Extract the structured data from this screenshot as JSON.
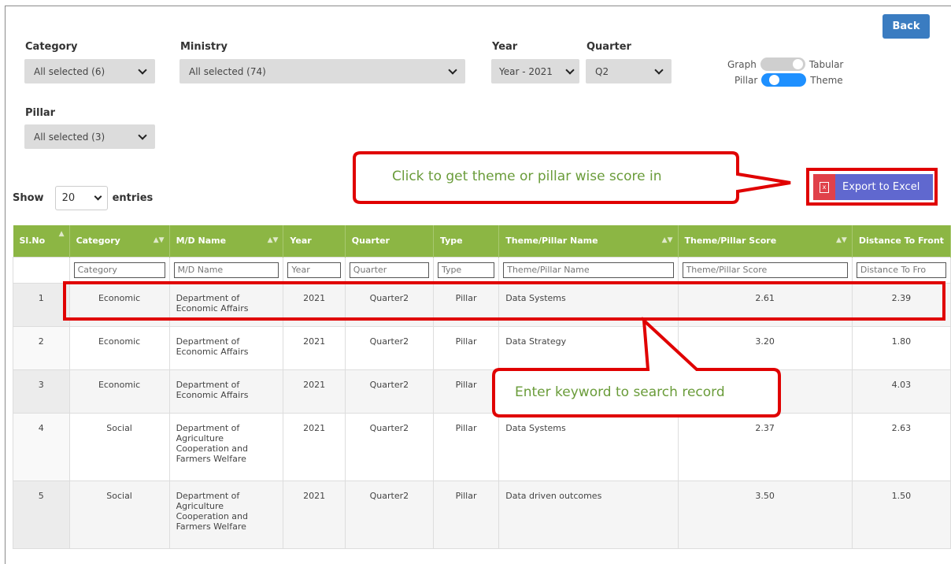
{
  "filters": {
    "category": {
      "label": "Category",
      "value": "All selected (6)"
    },
    "ministry": {
      "label": "Ministry",
      "value": "All selected (74)"
    },
    "year": {
      "label": "Year",
      "value": "Year - 2021"
    },
    "quarter": {
      "label": "Quarter",
      "value": "Q2"
    },
    "pillar": {
      "label": "Pillar",
      "value": "All selected (3)"
    }
  },
  "back_label": "Back",
  "toggles": {
    "graph_label": "Graph",
    "tabular_label": "Tabular",
    "pillar_label": "Pillar",
    "theme_label": "Theme"
  },
  "show": {
    "prefix": "Show",
    "value": "20",
    "suffix": "entries"
  },
  "export_label": "Export to Excel",
  "callouts": {
    "export": "Click to get theme or pillar wise score in",
    "search": "Enter keyword to search record"
  },
  "table": {
    "headers": [
      "Sl.No",
      "Category",
      "M/D Name",
      "Year",
      "Quarter",
      "Type",
      "Theme/Pillar Name",
      "Theme/Pillar Score",
      "Distance To Front"
    ],
    "filter_placeholders": [
      "Category",
      "M/D Name",
      "Year",
      "Quarter",
      "Type",
      "Theme/Pillar Name",
      "Theme/Pillar Score",
      "Distance To Fro"
    ],
    "rows": [
      [
        "1",
        "Economic",
        "Department of Economic Affairs",
        "2021",
        "Quarter2",
        "Pillar",
        "Data Systems",
        "2.61",
        "2.39"
      ],
      [
        "2",
        "Economic",
        "Department of Economic Affairs",
        "2021",
        "Quarter2",
        "Pillar",
        "Data Strategy",
        "3.20",
        "1.80"
      ],
      [
        "3",
        "Economic",
        "Department of Economic Affairs",
        "2021",
        "Quarter2",
        "Pillar",
        "",
        "",
        "4.03"
      ],
      [
        "4",
        "Social",
        "Department of Agriculture Cooperation and Farmers Welfare",
        "2021",
        "Quarter2",
        "Pillar",
        "Data Systems",
        "2.37",
        "2.63"
      ],
      [
        "5",
        "Social",
        "Department of Agriculture Cooperation and Farmers Welfare",
        "2021",
        "Quarter2",
        "Pillar",
        "Data driven outcomes",
        "3.50",
        "1.50"
      ]
    ]
  },
  "colors": {
    "header_green": "#8cb644",
    "back_blue": "#3a7cc1",
    "export_purple": "#6068cf",
    "highlight_red": "#e00000",
    "toggle_blue": "#1e90ff"
  }
}
